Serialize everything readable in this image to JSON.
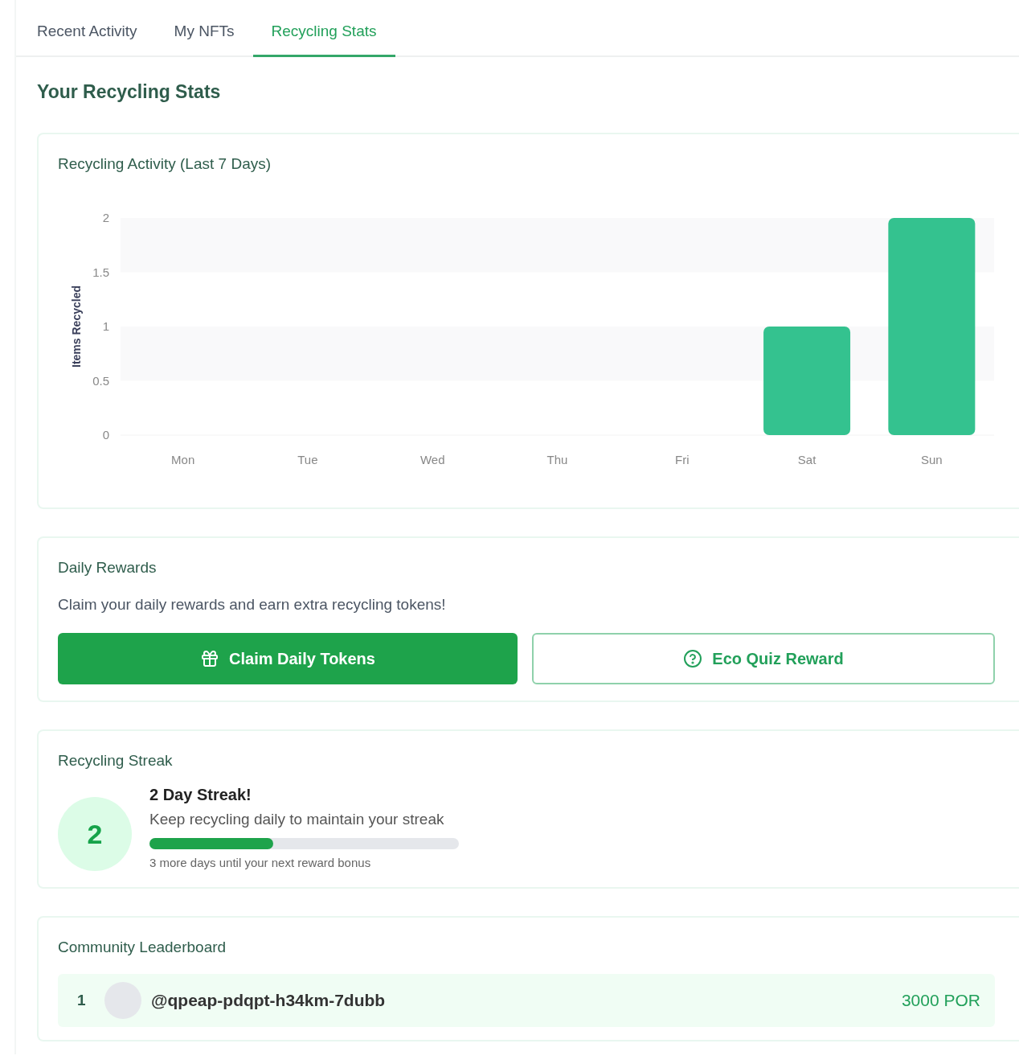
{
  "tabs": [
    {
      "label": "Recent Activity",
      "selected": false
    },
    {
      "label": "My NFTs",
      "selected": false
    },
    {
      "label": "Recycling Stats",
      "selected": true
    }
  ],
  "heading": "Your Recycling Stats",
  "activity": {
    "title": "Recycling Activity (Last 7 Days)",
    "chart_data": {
      "type": "bar",
      "ylabel": "Items Recycled",
      "categories": [
        "Mon",
        "Tue",
        "Wed",
        "Thu",
        "Fri",
        "Sat",
        "Sun"
      ],
      "series": [
        {
          "color": "#34c28f",
          "values": [
            0,
            0,
            0,
            0,
            0,
            1,
            2
          ]
        }
      ],
      "ylim": [
        0,
        2
      ],
      "yticks": [
        0,
        0.5,
        1,
        1.5,
        2
      ]
    }
  },
  "rewards": {
    "title": "Daily Rewards",
    "text": "Claim your daily rewards and earn extra recycling tokens!",
    "buttons": [
      {
        "label": "Claim Daily Tokens",
        "kind": "primary"
      },
      {
        "label": "Eco Quiz Reward",
        "kind": "outline"
      }
    ]
  },
  "streak": {
    "title": "Recycling Streak",
    "count": "2",
    "headline": "2 Day Streak!",
    "text": "Keep recycling daily to maintain your streak",
    "level": 0.4,
    "note": "3 more days until your next reward bonus"
  },
  "leaderboard": {
    "title": "Community Leaderboard",
    "rows": [
      {
        "rank": "1",
        "user": "@qpeap-pdqpt-h34km-7dubb",
        "score": "3000 POR"
      }
    ]
  }
}
